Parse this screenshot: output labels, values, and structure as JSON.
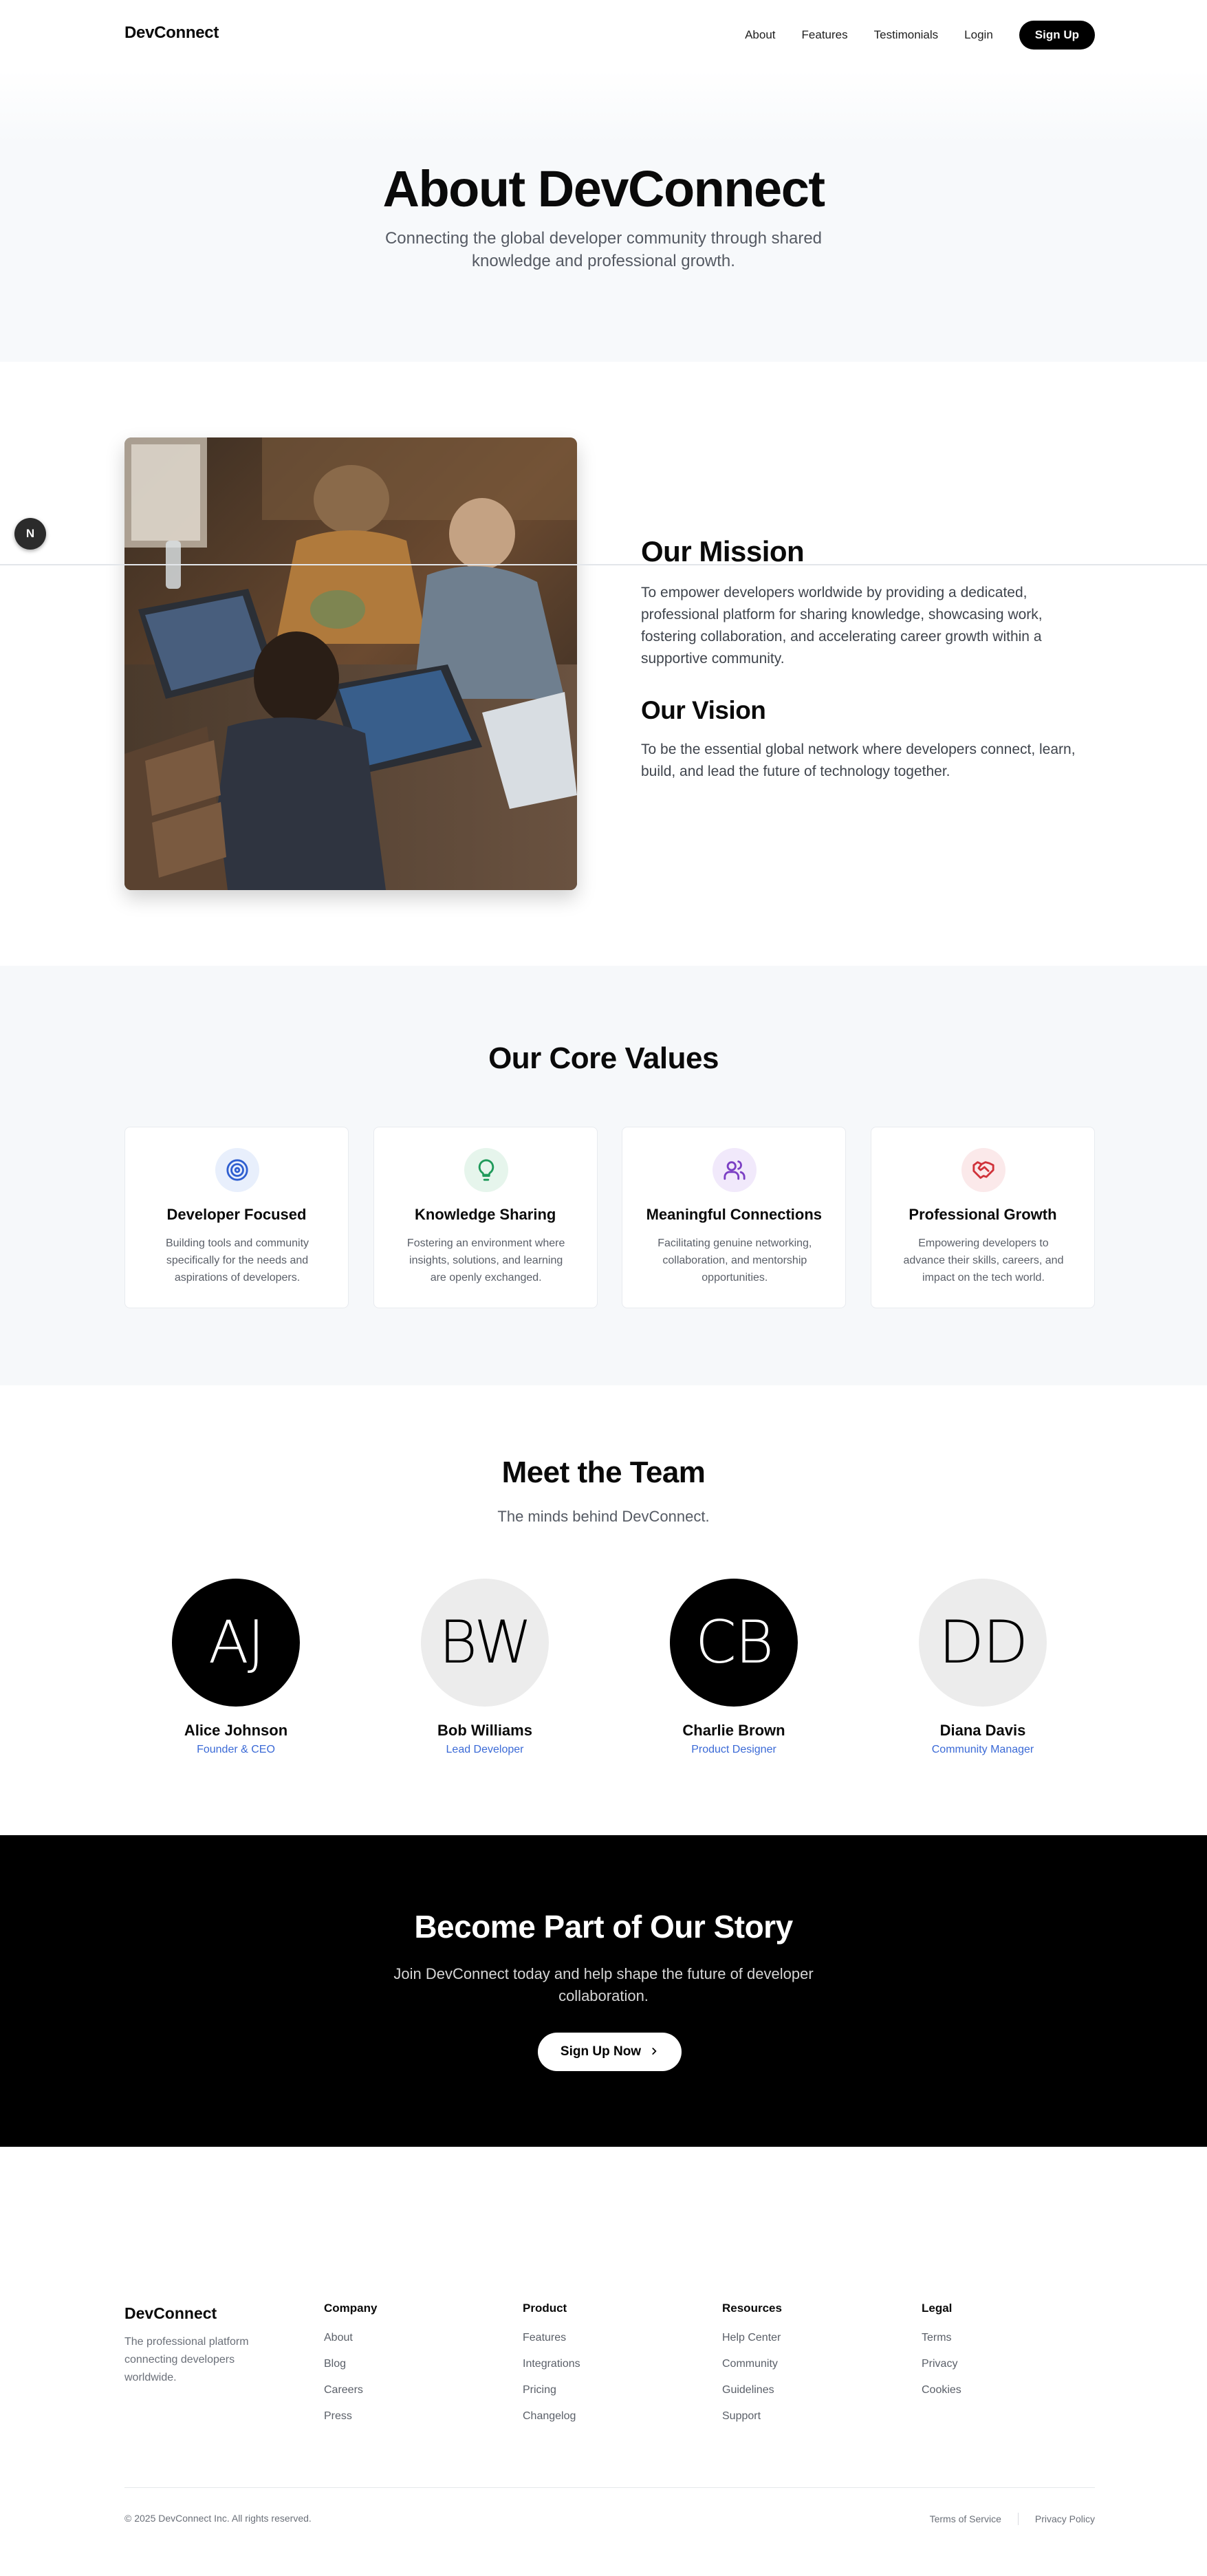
{
  "header": {
    "logo": "DevConnect",
    "nav": [
      "About",
      "Features",
      "Testimonials",
      "Login"
    ],
    "signup_label": "Sign Up"
  },
  "floating_badge": "N",
  "hero": {
    "title": "About DevConnect",
    "subtitle": "Connecting the global developer community through shared knowledge and professional growth."
  },
  "mission": {
    "image_alt": "Developers working together on laptops",
    "mission_title": "Our Mission",
    "mission_text": "To empower developers worldwide by providing a dedicated, professional platform for sharing knowledge, showcasing work, fostering collaboration, and accelerating career growth within a supportive community.",
    "vision_title": "Our Vision",
    "vision_text": "To be the essential global network where developers connect, learn, build, and lead the future of technology together."
  },
  "values": {
    "title": "Our Core Values",
    "items": [
      {
        "icon": "target-icon",
        "color": "#2f5fd0",
        "bg": "#e8effc",
        "title": "Developer Focused",
        "text": "Building tools and community specifically for the needs and aspirations of developers."
      },
      {
        "icon": "lightbulb-icon",
        "color": "#1f9a5a",
        "bg": "#e6f5ec",
        "title": "Knowledge Sharing",
        "text": "Fostering an environment where insights, solutions, and learning are openly exchanged."
      },
      {
        "icon": "users-icon",
        "color": "#7b3fc4",
        "bg": "#f1e9fb",
        "title": "Meaningful Connections",
        "text": "Facilitating genuine networking, collaboration, and mentorship opportunities."
      },
      {
        "icon": "handshake-icon",
        "color": "#d0323a",
        "bg": "#fbe9ea",
        "title": "Professional Growth",
        "text": "Empowering developers to advance their skills, careers, and impact on the tech world."
      }
    ]
  },
  "team": {
    "title": "Meet the Team",
    "subtitle": "The minds behind DevConnect.",
    "members": [
      {
        "initials": "AJ",
        "name": "Alice Johnson",
        "role": "Founder & CEO",
        "style": "dark"
      },
      {
        "initials": "BW",
        "name": "Bob Williams",
        "role": "Lead Developer",
        "style": "light"
      },
      {
        "initials": "CB",
        "name": "Charlie Brown",
        "role": "Product Designer",
        "style": "dark"
      },
      {
        "initials": "DD",
        "name": "Diana Davis",
        "role": "Community Manager",
        "style": "light"
      }
    ]
  },
  "cta": {
    "title": "Become Part of Our Story",
    "text": "Join DevConnect today and help shape the future of developer collaboration.",
    "button_label": "Sign Up Now"
  },
  "footer": {
    "brand": "DevConnect",
    "description": "The professional platform connecting developers worldwide.",
    "columns": [
      {
        "title": "Company",
        "links": [
          "About",
          "Blog",
          "Careers",
          "Press"
        ]
      },
      {
        "title": "Product",
        "links": [
          "Features",
          "Integrations",
          "Pricing",
          "Changelog"
        ]
      },
      {
        "title": "Resources",
        "links": [
          "Help Center",
          "Community",
          "Guidelines",
          "Support"
        ]
      },
      {
        "title": "Legal",
        "links": [
          "Terms",
          "Privacy",
          "Cookies"
        ]
      }
    ],
    "copyright": "© 2025 DevConnect Inc. All rights reserved.",
    "bottom_links": [
      "Terms of Service",
      "Privacy Policy"
    ]
  }
}
